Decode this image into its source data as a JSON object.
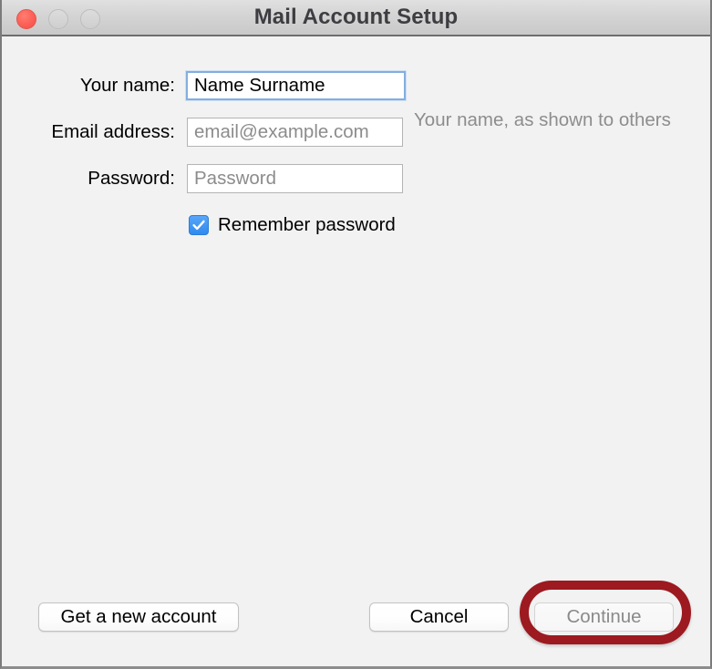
{
  "window": {
    "title": "Mail Account Setup",
    "background_color": "#f2f2f2",
    "titlebar_color": "#d4d4d4"
  },
  "traffic_lights": {
    "close_label": "close",
    "minimize_label": "minimize",
    "zoom_label": "zoom",
    "close_color": "#fc5f55",
    "inactive_color": "#d5d5d5"
  },
  "form": {
    "fields": [
      {
        "label": "Your name:",
        "value": "Name Surname",
        "placeholder": "",
        "hint": "Your name, as shown to others",
        "focused": true
      },
      {
        "label": "Email address:",
        "value": "",
        "placeholder": "email@example.com",
        "hint": "",
        "focused": false
      },
      {
        "label": "Password:",
        "value": "",
        "placeholder": "Password",
        "hint": "",
        "focused": false
      }
    ],
    "remember_password": {
      "label": "Remember password",
      "checked": true,
      "accent_color": "#3f92f0"
    }
  },
  "buttons": {
    "get_new_account": "Get a new account",
    "cancel": "Cancel",
    "continue": "Continue",
    "continue_disabled": true
  },
  "annotation": {
    "target": "Continue",
    "shape": "rounded-rectangle-outline",
    "color": "#9c1a20"
  }
}
